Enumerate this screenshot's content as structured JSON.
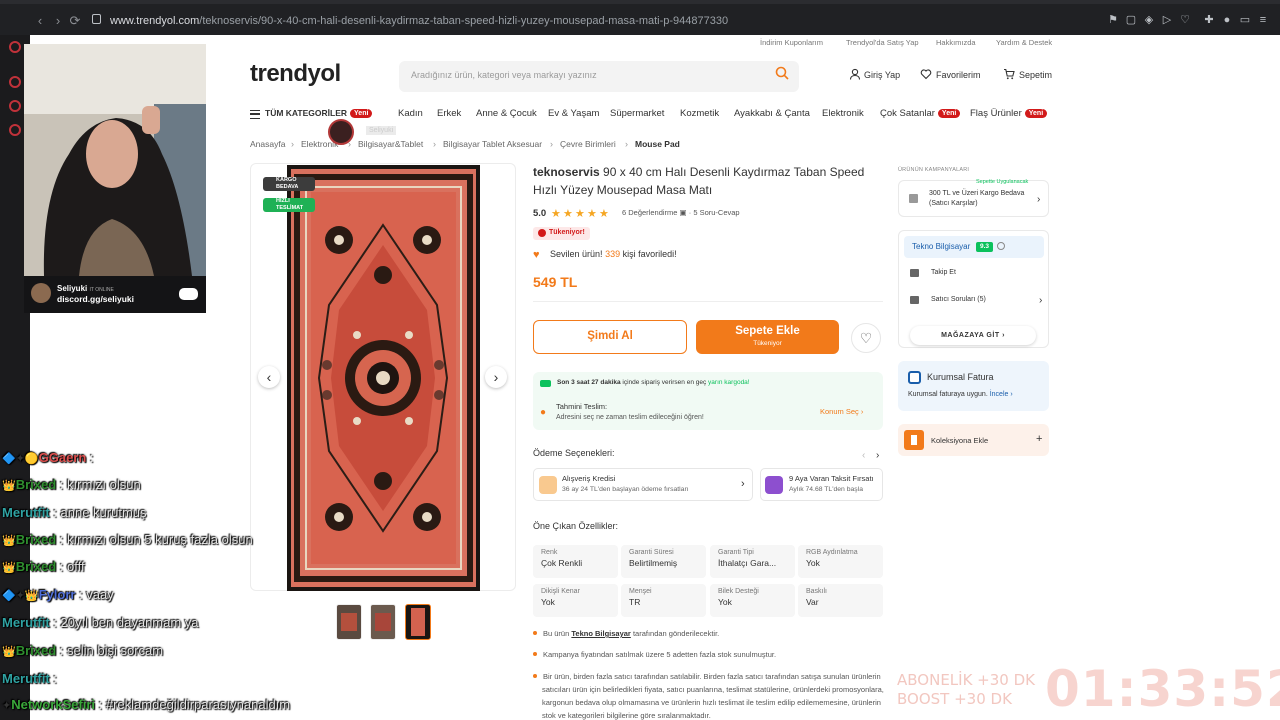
{
  "browser": {
    "url_host": "www.trendyol.com",
    "url_path": "/teknoservis/90-x-40-cm-hali-desenli-kaydirmaz-taban-speed-hizli-yuzey-mousepad-masa-mati-p-944877330"
  },
  "topnav": [
    "İndirim Kuponlarım",
    "Trendyol'da Satış Yap",
    "Hakkımızda",
    "Yardım & Destek"
  ],
  "logo": "trendyol",
  "search": {
    "placeholder": "Aradığınız ürün, kategori veya markayı yazınız"
  },
  "header": {
    "login": "Giriş Yap",
    "favorites": "Favorilerim",
    "cart": "Sepetim"
  },
  "categories": {
    "all": "TÜM KATEGORİLER",
    "new_badge": "Yeni",
    "items": [
      "Kadın",
      "Erkek",
      "Anne & Çocuk",
      "Ev & Yaşam",
      "Süpermarket",
      "Kozmetik",
      "Ayakkabı & Çanta",
      "Elektronik",
      "Çok Satanlar",
      "Flaş Ürünler"
    ]
  },
  "breadcrumbs": [
    "Anasayfa",
    "Elektronik",
    "Bilgisayar&Tablet",
    "Bilgisayar Tablet Aksesuar",
    "Çevre Birimleri",
    "Mouse Pad"
  ],
  "gallery": {
    "ribbon_cargo": "KARGO BEDAVA",
    "ribbon_fast": "HIZLI TESLİMAT"
  },
  "product": {
    "brand": "teknoservis",
    "name": "90 x 40 cm Halı Desenli Kaydırmaz Taban Speed Hızlı Yüzey Mousepad Masa Matı",
    "rating": "5.0",
    "rating_stars": 5,
    "reviews": "6 Değerlendirme",
    "qa": "5 Soru-Cevap",
    "stock_badge": "Tükeniyor!",
    "fav_prefix": "Sevilen ürün!",
    "fav_count": "339",
    "fav_suffix": "kişi favoriledi!",
    "price": "549 TL",
    "buy_now": "Şimdi Al",
    "add_to_cart": "Sepete Ekle",
    "add_to_cart_sub": "Tükeniyor"
  },
  "shipping": {
    "line1_pre": "Son 3 saat 27 dakika",
    "line1_mid": "içinde sipariş verirsen en geç",
    "line1_em": "yarın kargoda!",
    "est_title": "Tahmini Teslim:",
    "est_sub": "Adresini seç ne zaman teslim edileceğini öğren!",
    "location": "Konum Seç"
  },
  "payment": {
    "title": "Ödeme Seçenekleri:",
    "cards": [
      {
        "title": "Alışveriş Kredisi",
        "sub": "36 ay 24 TL'den başlayan ödeme fırsatları"
      },
      {
        "title": "9 Aya Varan Taksit Fırsatı",
        "sub": "Aylık 74.68 TL'den başla"
      }
    ]
  },
  "features": {
    "title": "Öne Çıkan Özellikler:",
    "items": [
      {
        "label": "Renk",
        "value": "Çok Renkli"
      },
      {
        "label": "Garanti Süresi",
        "value": "Belirtilmemiş"
      },
      {
        "label": "Garanti Tipi",
        "value": "İthalatçı Gara..."
      },
      {
        "label": "RGB Aydınlatma",
        "value": "Yok"
      },
      {
        "label": "Dikişli Kenar",
        "value": "Yok"
      },
      {
        "label": "Menşei",
        "value": "TR"
      },
      {
        "label": "Bilek Desteği",
        "value": "Yok"
      },
      {
        "label": "Baskılı",
        "value": "Var"
      }
    ]
  },
  "notes": {
    "n1_pre": "Bu ürün",
    "n1_seller": "Tekno Bilgisayar",
    "n1_post": "tarafından gönderilecektir.",
    "n2": "Kampanya fiyatından satılmak üzere 5 adetten fazla stok sunulmuştur.",
    "n3": "Bir ürün, birden fazla satıcı tarafından satılabilir. Birden fazla satıcı tarafından satışa sunulan ürünlerin satıcıları ürün için belirledikleri fiyata, satıcı puanlarına, teslimat statülerine, ürünlerdeki promosyonlara, kargonun bedava olup olmamasına ve ürünlerin hızlı teslimat ile teslim edilip edilememesine, ürünlerin stok ve kategorileri bilgilerine göre sıralanmaktadır."
  },
  "sidebar": {
    "campaign_label": "ÜRÜNÜN KAMPANYALARI",
    "campaign_tag": "Sepette Uygulanacak",
    "campaign_text": "300 TL ve Üzeri Kargo Bedava (Satıcı Karşılar)",
    "seller_name": "Tekno Bilgisayar",
    "seller_score": "9.3",
    "follow": "Takip Et",
    "seller_questions": "Satıcı Soruları (5)",
    "go_store": "MAĞAZAYA GİT",
    "corp_title": "Kurumsal Fatura",
    "corp_sub": "Kurumsal faturaya uygun.",
    "corp_link": "İncele",
    "collection": "Koleksiyona Ekle"
  },
  "stream": {
    "cam_user": "Seliyuki",
    "cam_status": "IT ONLINE",
    "cam_link": "discord.gg/seliyuki",
    "mini_label": "Seliyuki",
    "chat": [
      {
        "name": "GGaern",
        "color": "#e0504f",
        "msg": ":",
        "icons": "🔷✦🟡"
      },
      {
        "name": "Brixed",
        "color": "#2f8f2f",
        "msg": ": kırmızı olsun",
        "icons": "👑"
      },
      {
        "name": "Merutfit",
        "color": "#2fa3a3",
        "msg": ": anne kurutmuş",
        "icons": ""
      },
      {
        "name": "Brixed",
        "color": "#2f8f2f",
        "msg": ": kırmızı olsun 5 kuruş fazla olsun",
        "icons": "👑"
      },
      {
        "name": "Brixed",
        "color": "#2f8f2f",
        "msg": ": offf",
        "icons": "👑"
      },
      {
        "name": "Fylorr",
        "color": "#4f6fd9",
        "msg": ": vaay",
        "icons": "🔷✦👑"
      },
      {
        "name": "Merutfit",
        "color": "#2fa3a3",
        "msg": ": 20yıl ben dayanmam ya",
        "icons": ""
      },
      {
        "name": "Brixed",
        "color": "#2f8f2f",
        "msg": ": selin bişi sorcam",
        "icons": "👑"
      },
      {
        "name": "Merutfit",
        "color": "#2fa3a3",
        "msg": ":",
        "icons": ""
      },
      {
        "name": "NetworkSefiri",
        "color": "#3aa83a",
        "msg": ": #reklamdeğildirparasıynanaldım",
        "icons": "✦"
      }
    ],
    "sub_line1": "ABONELİK +30 DK",
    "sub_line2": "BOOST +30 DK",
    "timer": "01:33:52"
  },
  "colors": {
    "brand": "#f27a1a",
    "new_badge": "#d21a1a",
    "success": "#0bc15c"
  }
}
